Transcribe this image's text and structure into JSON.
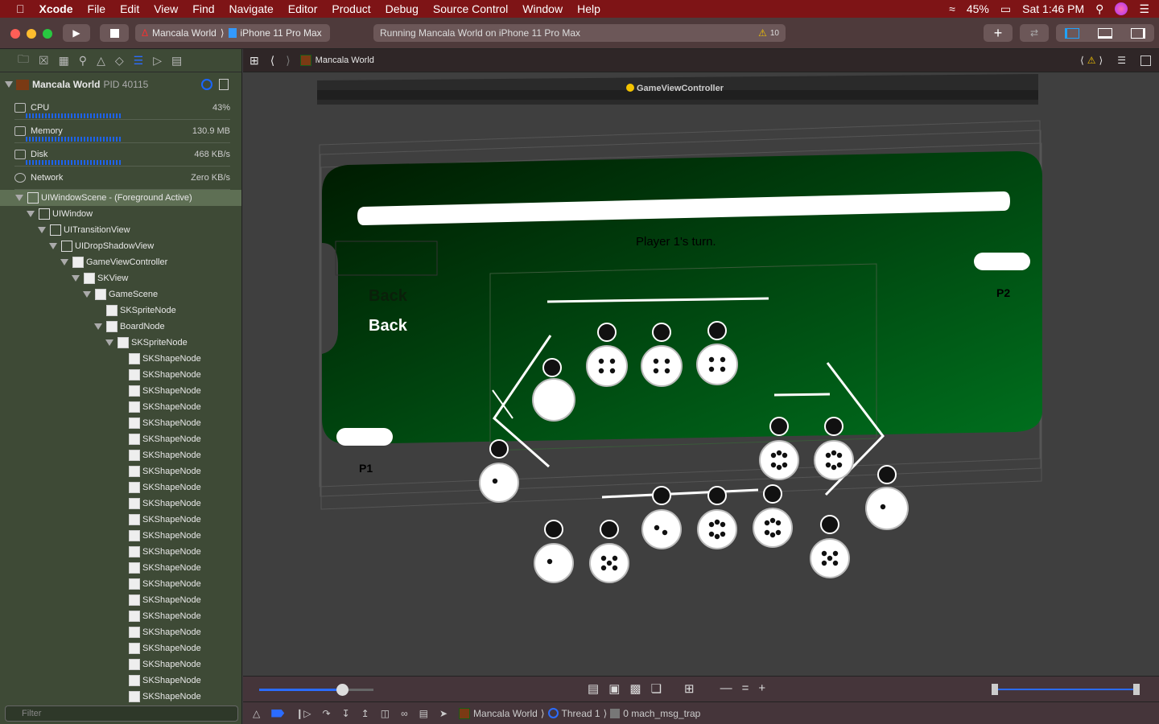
{
  "menubar": {
    "app": "Xcode",
    "items": [
      "File",
      "Edit",
      "View",
      "Find",
      "Navigate",
      "Editor",
      "Product",
      "Debug",
      "Source Control",
      "Window",
      "Help"
    ],
    "battery": "45%",
    "clock": "Sat 1:46 PM"
  },
  "toolbar": {
    "scheme": "Mancala World",
    "device": "iPhone 11 Pro Max",
    "activity": "Running Mancala World on iPhone 11 Pro Max",
    "warnings": "10"
  },
  "process": {
    "name": "Mancala World",
    "pid": "PID 40115"
  },
  "gauges": [
    {
      "name": "CPU",
      "value": "43%"
    },
    {
      "name": "Memory",
      "value": "130.9 MB"
    },
    {
      "name": "Disk",
      "value": "468 KB/s"
    },
    {
      "name": "Network",
      "value": "Zero KB/s"
    }
  ],
  "tree": [
    {
      "label": "UIWindowScene - (Foreground Active)",
      "depth": 0,
      "expand": true,
      "selected": true
    },
    {
      "label": "UIWindow",
      "depth": 1,
      "expand": true
    },
    {
      "label": "UITransitionView",
      "depth": 2,
      "expand": true
    },
    {
      "label": "UIDropShadowView",
      "depth": 3,
      "expand": true
    },
    {
      "label": "GameViewController",
      "depth": 4,
      "expand": true
    },
    {
      "label": "SKView",
      "depth": 5,
      "expand": true
    },
    {
      "label": "GameScene",
      "depth": 6,
      "expand": true
    },
    {
      "label": "SKSpriteNode",
      "depth": 7,
      "expand": false
    },
    {
      "label": "BoardNode",
      "depth": 7,
      "expand": true
    },
    {
      "label": "SKSpriteNode",
      "depth": 8,
      "expand": true
    },
    {
      "label": "SKShapeNode",
      "depth": 9
    },
    {
      "label": "SKShapeNode",
      "depth": 9
    },
    {
      "label": "SKShapeNode",
      "depth": 9
    },
    {
      "label": "SKShapeNode",
      "depth": 9
    },
    {
      "label": "SKShapeNode",
      "depth": 9
    },
    {
      "label": "SKShapeNode",
      "depth": 9
    },
    {
      "label": "SKShapeNode",
      "depth": 9
    },
    {
      "label": "SKShapeNode",
      "depth": 9
    },
    {
      "label": "SKShapeNode",
      "depth": 9
    },
    {
      "label": "SKShapeNode",
      "depth": 9
    },
    {
      "label": "SKShapeNode",
      "depth": 9
    },
    {
      "label": "SKShapeNode",
      "depth": 9
    },
    {
      "label": "SKShapeNode",
      "depth": 9
    },
    {
      "label": "SKShapeNode",
      "depth": 9
    },
    {
      "label": "SKShapeNode",
      "depth": 9
    },
    {
      "label": "SKShapeNode",
      "depth": 9
    },
    {
      "label": "SKShapeNode",
      "depth": 9
    },
    {
      "label": "SKShapeNode",
      "depth": 9
    },
    {
      "label": "SKShapeNode",
      "depth": 9
    },
    {
      "label": "SKShapeNode",
      "depth": 9
    },
    {
      "label": "SKShapeNode",
      "depth": 9
    },
    {
      "label": "SKShapeNode",
      "depth": 9
    }
  ],
  "filter": {
    "placeholder": "Filter"
  },
  "jumpbar": {
    "title": "Mancala World"
  },
  "scene": {
    "controller": "GameViewController",
    "turn": "Player 1's turn.",
    "back": "Back",
    "back_ghost": "Back",
    "p1": "P1",
    "p2": "P2",
    "top_pit_stones": [
      4,
      4,
      4
    ],
    "bottom_pit_stones": [
      6,
      6,
      1,
      1,
      5,
      2,
      6,
      6,
      5,
      1
    ]
  },
  "debugbar": {
    "process": "Mancala World",
    "thread": "Thread 1",
    "frame": "0 mach_msg_trap"
  },
  "colors": {
    "menubar": "#7e1416",
    "sidebar": "#3e4a36",
    "accent": "#1a66ff",
    "board_dark": "#001a00",
    "board_light": "#00701e"
  }
}
